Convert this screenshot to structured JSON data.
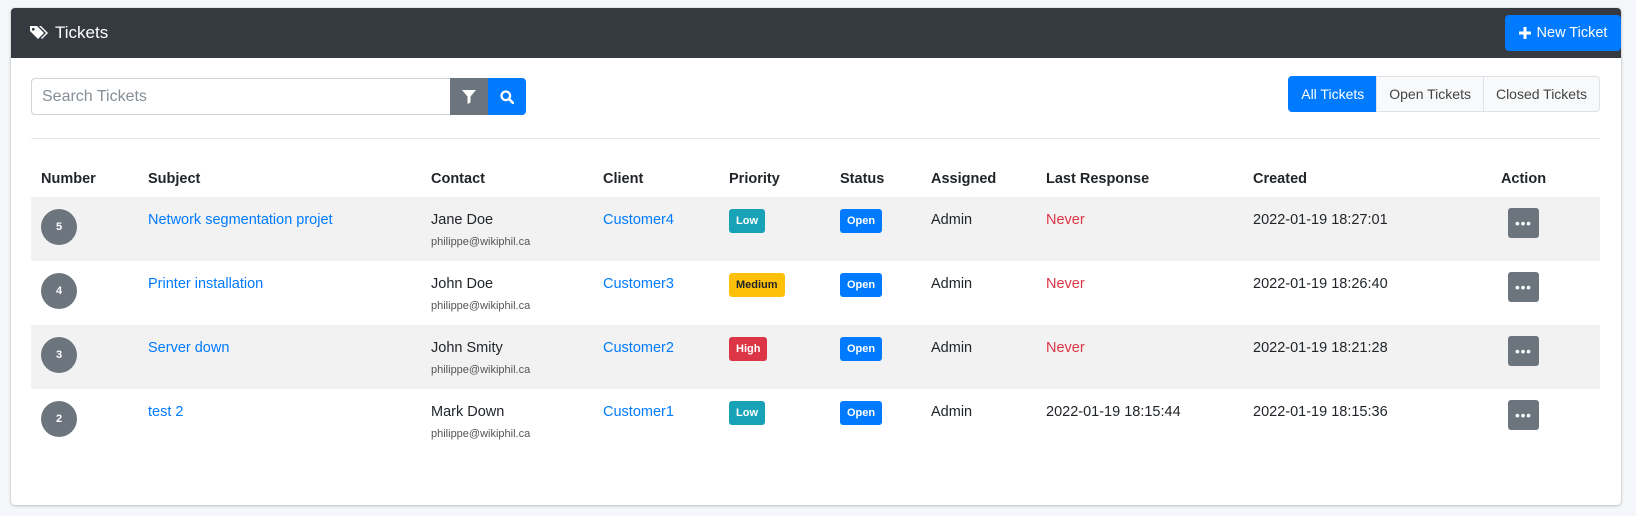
{
  "header": {
    "title": "Tickets",
    "new_ticket_label": "New Ticket"
  },
  "search": {
    "placeholder": "Search Tickets",
    "value": ""
  },
  "filters": [
    {
      "label": "All Tickets",
      "active": true
    },
    {
      "label": "Open Tickets",
      "active": false
    },
    {
      "label": "Closed Tickets",
      "active": false
    }
  ],
  "columns": [
    "Number",
    "Subject",
    "Contact",
    "Client",
    "Priority",
    "Status",
    "Assigned",
    "Last Response",
    "Created",
    "Action"
  ],
  "colors": {
    "header_bg": "#343a40",
    "primary": "#007bff",
    "secondary": "#6c757d",
    "low": "#17a2b8",
    "medium": "#ffc107",
    "high": "#dc3545",
    "never": "#dc3545"
  },
  "tickets": [
    {
      "number": "5",
      "subject": "Network segmentation projet",
      "contact_name": "Jane Doe",
      "contact_email": "philippe@wikiphil.ca",
      "client": "Customer4",
      "priority": "Low",
      "status": "Open",
      "assigned": "Admin",
      "last_response": "Never",
      "created": "2022-01-19 18:27:01"
    },
    {
      "number": "4",
      "subject": "Printer installation",
      "contact_name": "John Doe",
      "contact_email": "philippe@wikiphil.ca",
      "client": "Customer3",
      "priority": "Medium",
      "status": "Open",
      "assigned": "Admin",
      "last_response": "Never",
      "created": "2022-01-19 18:26:40"
    },
    {
      "number": "3",
      "subject": "Server down",
      "contact_name": "John Smity",
      "contact_email": "philippe@wikiphil.ca",
      "client": "Customer2",
      "priority": "High",
      "status": "Open",
      "assigned": "Admin",
      "last_response": "Never",
      "created": "2022-01-19 18:21:28"
    },
    {
      "number": "2",
      "subject": "test 2",
      "contact_name": "Mark Down",
      "contact_email": "philippe@wikiphil.ca",
      "client": "Customer1",
      "priority": "Low",
      "status": "Open",
      "assigned": "Admin",
      "last_response": "2022-01-19 18:15:44",
      "created": "2022-01-19 18:15:36"
    }
  ]
}
